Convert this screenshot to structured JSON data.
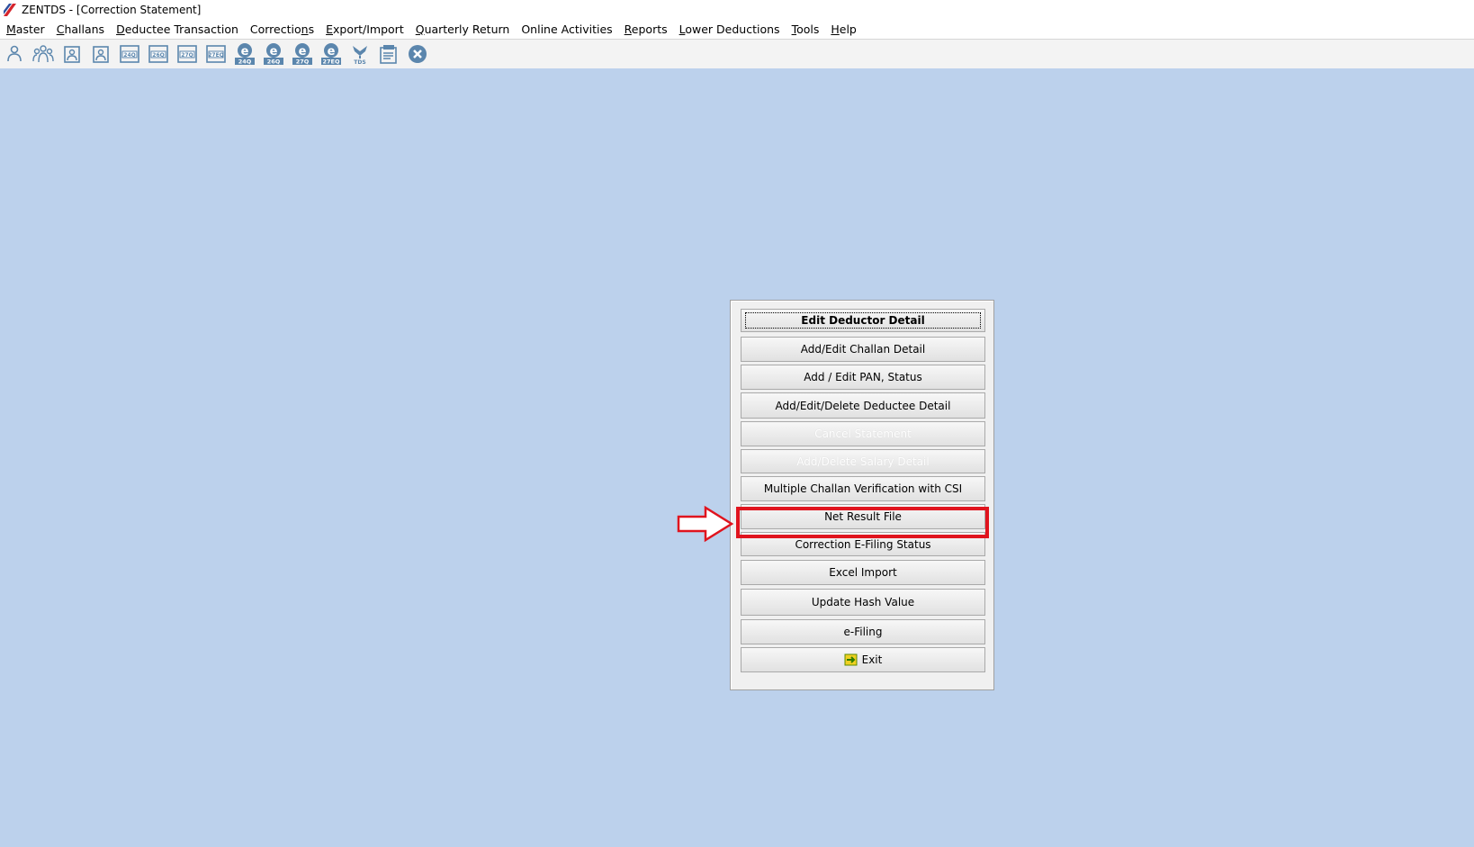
{
  "window": {
    "title": "ZENTDS - [Correction Statement]"
  },
  "menu": [
    {
      "label": "Master",
      "mnemonic_index": 0
    },
    {
      "label": "Challans",
      "mnemonic_index": 0
    },
    {
      "label": "Deductee Transaction",
      "mnemonic_index": 0
    },
    {
      "label": "Corrections",
      "mnemonic_index": 9
    },
    {
      "label": "Export/Import",
      "mnemonic_index": 0
    },
    {
      "label": "Quarterly Return",
      "mnemonic_index": 0
    },
    {
      "label": "Online Activities",
      "mnemonic_index": -1
    },
    {
      "label": "Reports",
      "mnemonic_index": 0
    },
    {
      "label": "Lower Deductions",
      "mnemonic_index": 0
    },
    {
      "label": "Tools",
      "mnemonic_index": 0
    },
    {
      "label": "Help",
      "mnemonic_index": 0
    }
  ],
  "toolbar": [
    {
      "icon": "deductor-icon",
      "badge": ""
    },
    {
      "icon": "deductees-icon",
      "badge": ""
    },
    {
      "icon": "deductee-form-icon",
      "badge": ""
    },
    {
      "icon": "deductee-form-2-icon",
      "badge": ""
    },
    {
      "icon": "form-24q-icon",
      "badge": "24Q"
    },
    {
      "icon": "form-26q-icon",
      "badge": "26Q"
    },
    {
      "icon": "form-27q-icon",
      "badge": "27Q"
    },
    {
      "icon": "form-27eq-icon",
      "badge": "27EQ"
    },
    {
      "icon": "efile-24q-icon",
      "badge": "24Q"
    },
    {
      "icon": "efile-26q-icon",
      "badge": "26Q"
    },
    {
      "icon": "efile-27q-icon",
      "badge": "27Q"
    },
    {
      "icon": "efile-27eq-icon",
      "badge": "27EQ"
    },
    {
      "icon": "tds-icon",
      "badge": "TDS"
    },
    {
      "icon": "report-icon",
      "badge": ""
    },
    {
      "icon": "close-icon",
      "badge": ""
    }
  ],
  "buttons": [
    {
      "label": "Edit Deductor Detail",
      "state": "primary"
    },
    {
      "label": "Add/Edit Challan Detail",
      "state": "normal"
    },
    {
      "label": "Add / Edit PAN, Status",
      "state": "normal"
    },
    {
      "label": "Add/Edit/Delete Deductee Detail",
      "state": "normal"
    },
    {
      "label": "Cancel Statement",
      "state": "disabled"
    },
    {
      "label": "Add/Delete Salary Detail",
      "state": "disabled"
    },
    {
      "label": "Multiple Challan Verification with CSI",
      "state": "normal"
    },
    {
      "label": "Net Result File",
      "state": "highlighted"
    },
    {
      "label": "Correction E-Filing Status",
      "state": "normal"
    },
    {
      "label": "Excel Import",
      "state": "normal"
    },
    {
      "label": "Update Hash Value",
      "state": "normal"
    },
    {
      "label": "e-Filing",
      "state": "normal"
    },
    {
      "label": "Exit",
      "state": "normal",
      "icon": "exit-icon"
    }
  ],
  "colors": {
    "background": "#bcd1ec",
    "highlight": "#e0141e",
    "icon_blue": "#5b86ad"
  }
}
